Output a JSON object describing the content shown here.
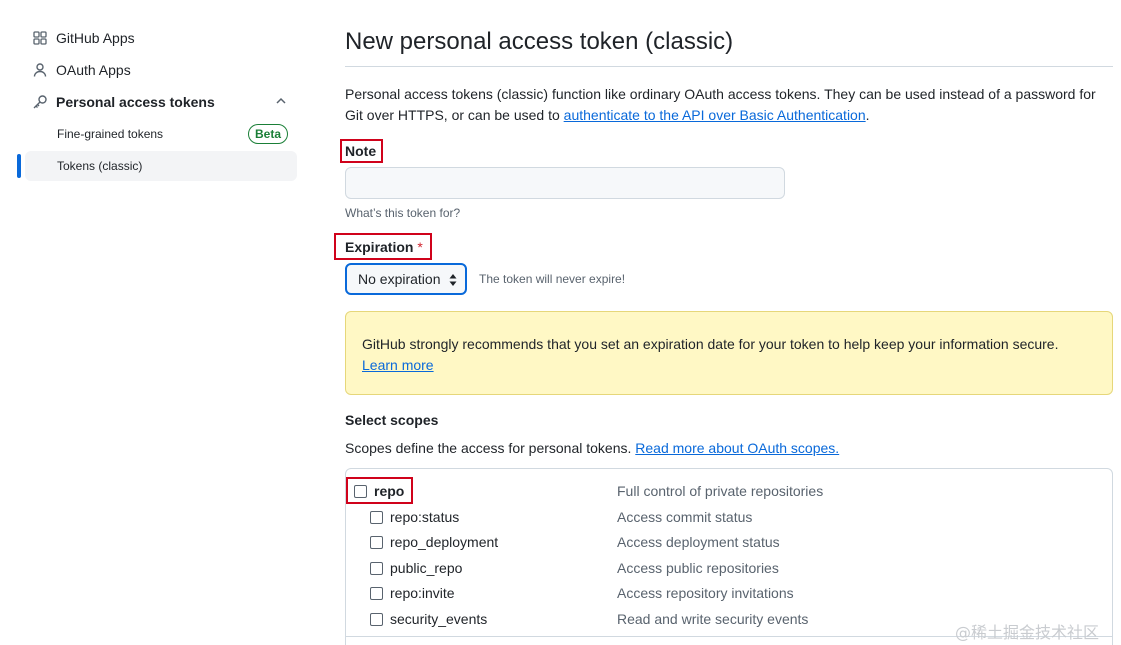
{
  "sidebar": {
    "items": [
      {
        "label": "GitHub Apps",
        "icon": "apps-icon"
      },
      {
        "label": "OAuth Apps",
        "icon": "person-icon"
      },
      {
        "label": "Personal access tokens",
        "icon": "key-icon"
      }
    ],
    "sub_items": [
      {
        "label": "Fine-grained tokens",
        "badge": "Beta"
      },
      {
        "label": "Tokens (classic)",
        "active": true
      }
    ]
  },
  "main": {
    "title": "New personal access token (classic)",
    "intro_text": "Personal access tokens (classic) function like ordinary OAuth access tokens. They can be used instead of a password for Git over HTTPS, or can be used to ",
    "intro_link": "authenticate to the API over Basic Authentication",
    "intro_end": ".",
    "note": {
      "label": "Note",
      "value": "",
      "hint": "What’s this token for?"
    },
    "expiration": {
      "label": "Expiration",
      "required_mark": "*",
      "selected": "No expiration",
      "note": "The token will never expire!"
    },
    "flash": {
      "text": "GitHub strongly recommends that you set an expiration date for your token to help keep your information secure.",
      "link": "Learn more"
    },
    "scopes": {
      "title": "Select scopes",
      "desc": "Scopes define the access for personal tokens. ",
      "desc_link": "Read more about OAuth scopes.",
      "items": [
        {
          "name": "repo",
          "desc": "Full control of private repositories",
          "checked": false
        },
        {
          "name": "repo:status",
          "desc": "Access commit status",
          "checked": false
        },
        {
          "name": "repo_deployment",
          "desc": "Access deployment status",
          "checked": false
        },
        {
          "name": "public_repo",
          "desc": "Access public repositories",
          "checked": false
        },
        {
          "name": "repo:invite",
          "desc": "Access repository invitations",
          "checked": false
        },
        {
          "name": "security_events",
          "desc": "Read and write security events",
          "checked": false
        }
      ]
    }
  },
  "watermark": "@稀土掘金技术社区",
  "colors": {
    "accent": "#0969da",
    "success": "#1a7f37",
    "highlight_box": "#d0021b",
    "warning_bg": "#fff8c5"
  }
}
